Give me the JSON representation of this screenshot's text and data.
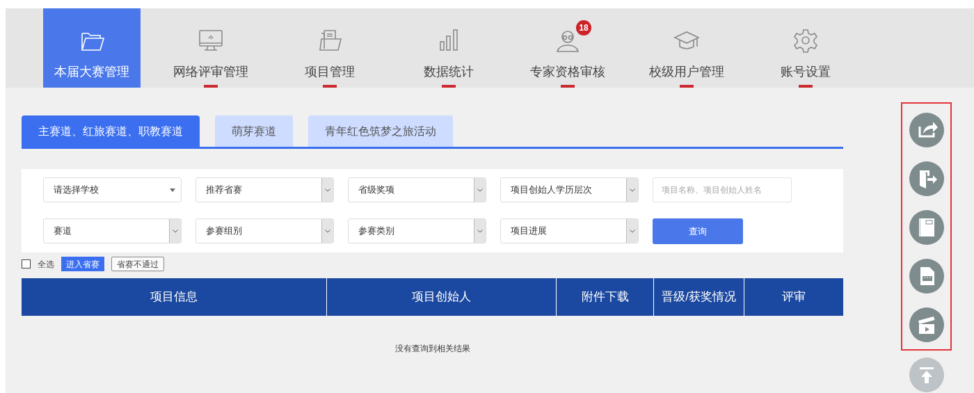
{
  "nav": {
    "items": [
      {
        "label": "本届大赛管理",
        "selected": true,
        "kind": "folder"
      },
      {
        "label": "网络评审管理",
        "selected": false,
        "kind": "monitor"
      },
      {
        "label": "项目管理",
        "selected": false,
        "kind": "files"
      },
      {
        "label": "数据统计",
        "selected": false,
        "kind": "bars"
      },
      {
        "label": "专家资格审核",
        "selected": false,
        "kind": "expert",
        "badge": "18"
      },
      {
        "label": "校级用户管理",
        "selected": false,
        "kind": "cap"
      },
      {
        "label": "账号设置",
        "selected": false,
        "kind": "gear"
      }
    ]
  },
  "tabs": [
    {
      "label": "主赛道、红旅赛道、职教赛道",
      "selected": true
    },
    {
      "label": "萌芽赛道",
      "selected": false
    },
    {
      "label": "青年红色筑梦之旅活动",
      "selected": false
    }
  ],
  "filters": [
    [
      {
        "kind": "dropdown",
        "text": "请选择学校"
      },
      {
        "kind": "select",
        "text": "推荐省赛"
      },
      {
        "kind": "select",
        "text": "省级奖项"
      },
      {
        "kind": "select",
        "text": "项目创始人学历层次"
      },
      {
        "kind": "search",
        "placeholder": "项目名称、项目创始人姓名"
      }
    ],
    [
      {
        "kind": "select",
        "text": "赛道"
      },
      {
        "kind": "select",
        "text": "参赛组别"
      },
      {
        "kind": "select",
        "text": "参赛类别"
      },
      {
        "kind": "select",
        "text": "项目进展"
      },
      {
        "kind": "button",
        "text": "查询"
      }
    ]
  ],
  "bulk": {
    "select_all": {
      "label": "全选",
      "checked": false
    },
    "buttons": [
      {
        "label": "进入省赛",
        "kind": "primary"
      },
      {
        "label": "省赛不通过",
        "kind": "outline"
      }
    ]
  },
  "table": {
    "columns": [
      "项目信息",
      "项目创始人",
      "附件下载",
      "晋级/获奖情况",
      "评审"
    ],
    "empty_message": "没有查询到相关结果"
  },
  "side_tools": [
    {
      "kind": "share"
    },
    {
      "kind": "exit"
    },
    {
      "kind": "notebook"
    },
    {
      "kind": "ppt"
    },
    {
      "kind": "video"
    }
  ],
  "back_to_top": {
    "kind": "top"
  }
}
